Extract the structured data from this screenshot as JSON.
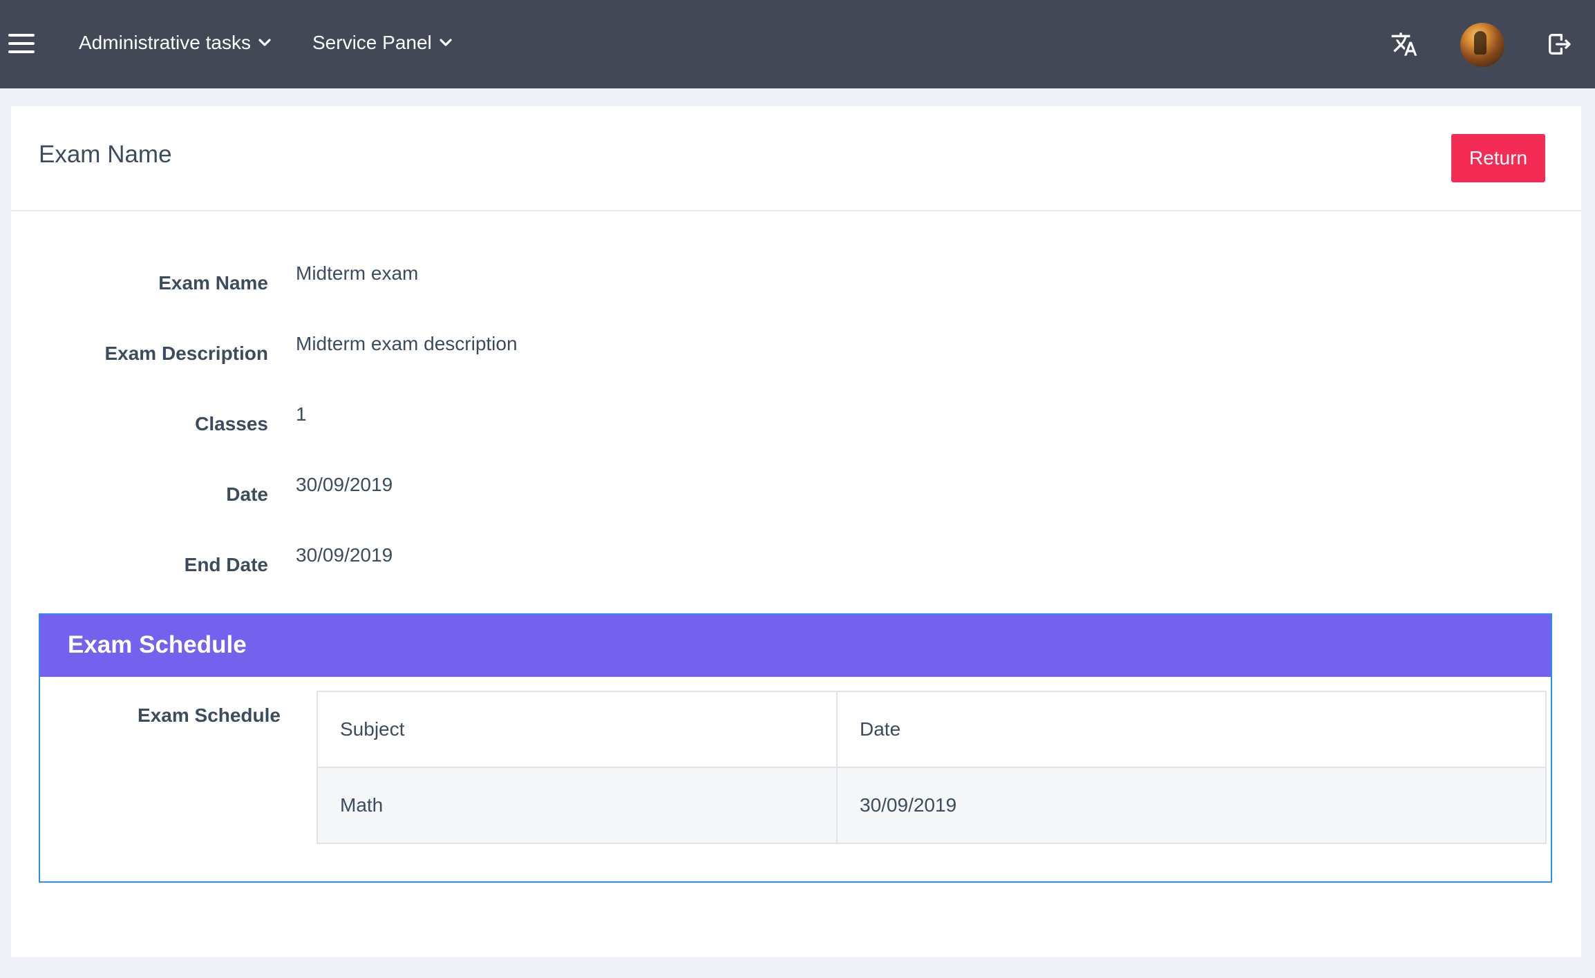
{
  "navbar": {
    "menus": [
      {
        "label": "Administrative tasks",
        "icon": "chevron-down-icon"
      },
      {
        "label": "Service Panel",
        "icon": "chevron-down-icon"
      }
    ],
    "icons": {
      "menu": "hamburger-menu-icon",
      "translate": "translate-icon",
      "avatar": "user-avatar",
      "logout": "logout-icon"
    },
    "colors": {
      "background": "#424856",
      "text": "#ffffff"
    }
  },
  "card": {
    "title": "Exam Name",
    "return_label": "Return",
    "return_color": "#f42c55"
  },
  "fields": [
    {
      "label": "Exam Name",
      "value": "Midterm exam"
    },
    {
      "label": "Exam Description",
      "value": "Midterm exam description"
    },
    {
      "label": "Classes",
      "value": "1"
    },
    {
      "label": "Date",
      "value": "30/09/2019"
    },
    {
      "label": "End Date",
      "value": "30/09/2019"
    }
  ],
  "schedule": {
    "title": "Exam Schedule",
    "label": "Exam Schedule",
    "header_color": "#7462ee",
    "border_color": "#2b8ef0",
    "columns": [
      "Subject",
      "Date"
    ],
    "rows": [
      {
        "subject": "Math",
        "date": "30/09/2019"
      }
    ]
  }
}
